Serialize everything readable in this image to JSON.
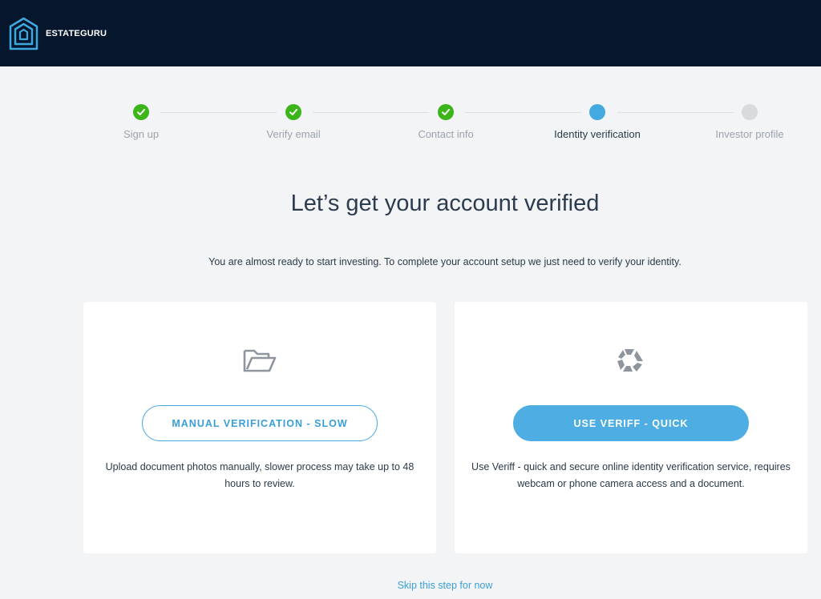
{
  "header": {
    "brand": "ESTATEGURU",
    "logo_icon": "house-logo-icon",
    "background_color": "#06162d"
  },
  "stepper": {
    "steps": [
      {
        "label": "Sign up",
        "state": "done"
      },
      {
        "label": "Verify email",
        "state": "done"
      },
      {
        "label": "Contact info",
        "state": "done"
      },
      {
        "label": "Identity verification",
        "state": "active"
      },
      {
        "label": "Investor profile",
        "state": "pending"
      }
    ],
    "colors": {
      "done": "#3bb51a",
      "active": "#44a9e0",
      "pending": "#d9dadd"
    }
  },
  "main": {
    "title": "Let’s get your account verified",
    "subtitle": "You are almost ready to start investing. To complete your account setup we just need to verify your identity."
  },
  "options": {
    "manual": {
      "icon": "folder-open-icon",
      "button_label": "MANUAL VERIFICATION - SLOW",
      "description": "Upload document photos manually, slower process may take up to 48 hours to review."
    },
    "veriff": {
      "icon": "veriff-logo-icon",
      "button_label": "USE VERIFF - QUICK",
      "description": "Use Veriff - quick and secure online identity verification service, requires webcam or phone camera access and a document."
    }
  },
  "footer": {
    "skip_label": "Skip this step for now"
  },
  "accent_color": "#4eaee3"
}
